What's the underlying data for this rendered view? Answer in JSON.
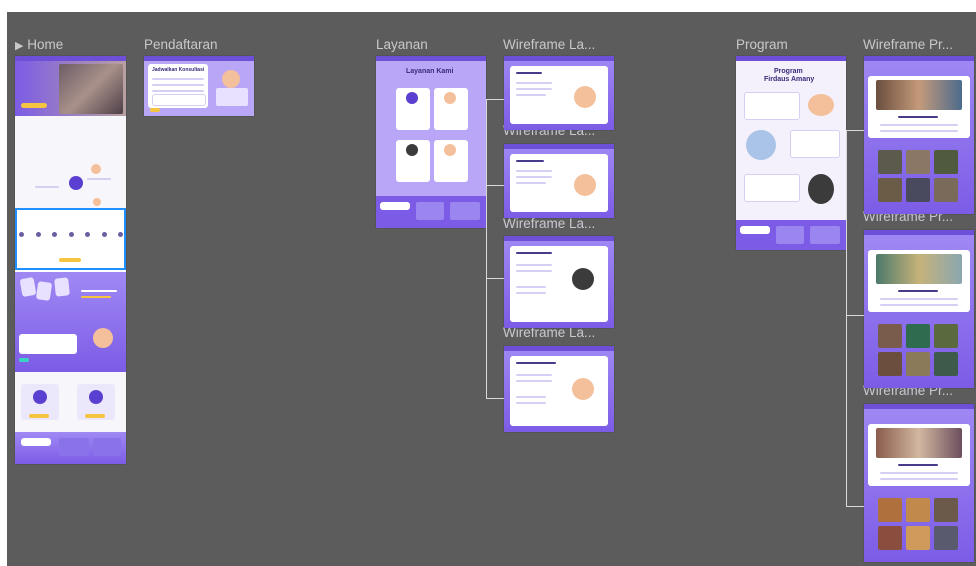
{
  "canvas": {
    "background": "#5c5c5c"
  },
  "frames": {
    "home_label": "Home",
    "pendaftaran_label": "Pendaftaran",
    "layanan_label": "Layanan",
    "wireframe_layanan_label": "Wireframe La...",
    "program_label": "Program",
    "wireframe_program_label": "Wireframe Pr..."
  },
  "layanan": {
    "title": "Layanan Kami"
  },
  "program": {
    "title_line1": "Program",
    "title_line2": "Firdaus Amany"
  },
  "pendaftaran": {
    "form_title": "Jadwalkan Konsultasi"
  },
  "colors": {
    "accent": "#7c5ce6",
    "highlight": "#f5c542",
    "selection": "#1e90ff"
  }
}
